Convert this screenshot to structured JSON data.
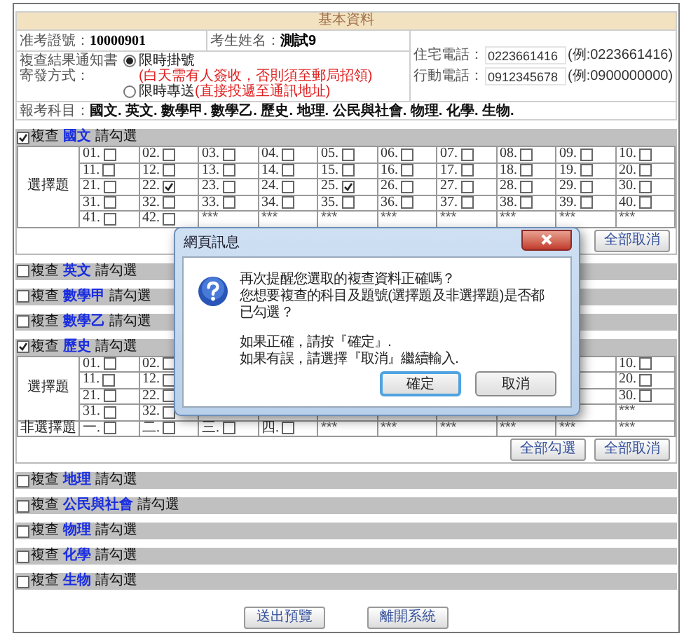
{
  "basic_info": {
    "title": "基本資料",
    "exam_no": {
      "label": "准考證號：",
      "value": "10000901"
    },
    "name": {
      "label": "考生姓名：",
      "value": "測試9"
    },
    "phones": [
      {
        "label": "住宅電話：",
        "value": "0223661416",
        "example": "(例:0223661416)"
      },
      {
        "label": "行動電話：",
        "value": "0912345678",
        "example": "(例:0900000000)"
      }
    ],
    "delivery": {
      "label": "複查結果通知書寄發方式：",
      "options": [
        {
          "label": "限時掛號",
          "note": "(白天需有人簽收，否則須至郵局招領)",
          "selected": true
        },
        {
          "label": "限時專送",
          "note": "(直接投遞至通訊地址)",
          "selected": false
        }
      ]
    },
    "subjects": {
      "label": "報考科目：",
      "value": "國文. 英文. 數學甲. 數學乙. 歷史. 地理. 公民與社會. 物理. 化學. 生物."
    }
  },
  "sections": [
    {
      "prefix": "複查",
      "subject": "國文",
      "suffix": "請勾選",
      "checked": true,
      "table": {
        "groups": [
          {
            "label": "選擇題",
            "rows": [
              [
                {
                  "kind": "item",
                  "label": "01.",
                  "checked": false
                },
                {
                  "kind": "item",
                  "label": "02.",
                  "checked": false
                },
                {
                  "kind": "item",
                  "label": "03.",
                  "checked": false
                },
                {
                  "kind": "item",
                  "label": "04.",
                  "checked": false
                },
                {
                  "kind": "item",
                  "label": "05.",
                  "checked": false
                },
                {
                  "kind": "item",
                  "label": "06.",
                  "checked": false
                },
                {
                  "kind": "item",
                  "label": "07.",
                  "checked": false
                },
                {
                  "kind": "item",
                  "label": "08.",
                  "checked": false
                },
                {
                  "kind": "item",
                  "label": "09.",
                  "checked": false
                },
                {
                  "kind": "item",
                  "label": "10.",
                  "checked": false
                }
              ],
              [
                {
                  "kind": "item",
                  "label": "11.",
                  "checked": false
                },
                {
                  "kind": "item",
                  "label": "12.",
                  "checked": false
                },
                {
                  "kind": "item",
                  "label": "13.",
                  "checked": false
                },
                {
                  "kind": "item",
                  "label": "14.",
                  "checked": false
                },
                {
                  "kind": "item",
                  "label": "15.",
                  "checked": false
                },
                {
                  "kind": "item",
                  "label": "16.",
                  "checked": false
                },
                {
                  "kind": "item",
                  "label": "17.",
                  "checked": false
                },
                {
                  "kind": "item",
                  "label": "18.",
                  "checked": false
                },
                {
                  "kind": "item",
                  "label": "19.",
                  "checked": false
                },
                {
                  "kind": "item",
                  "label": "20.",
                  "checked": false
                }
              ],
              [
                {
                  "kind": "item",
                  "label": "21.",
                  "checked": false
                },
                {
                  "kind": "item",
                  "label": "22.",
                  "checked": true
                },
                {
                  "kind": "item",
                  "label": "23.",
                  "checked": false
                },
                {
                  "kind": "item",
                  "label": "24.",
                  "checked": false
                },
                {
                  "kind": "item",
                  "label": "25.",
                  "checked": true
                },
                {
                  "kind": "item",
                  "label": "26.",
                  "checked": false
                },
                {
                  "kind": "item",
                  "label": "27.",
                  "checked": false
                },
                {
                  "kind": "item",
                  "label": "28.",
                  "checked": false
                },
                {
                  "kind": "item",
                  "label": "29.",
                  "checked": false
                },
                {
                  "kind": "item",
                  "label": "30.",
                  "checked": false
                }
              ],
              [
                {
                  "kind": "item",
                  "label": "31.",
                  "checked": false
                },
                {
                  "kind": "item",
                  "label": "32.",
                  "checked": false
                },
                {
                  "kind": "item",
                  "label": "33.",
                  "checked": false
                },
                {
                  "kind": "item",
                  "label": "34.",
                  "checked": false
                },
                {
                  "kind": "item",
                  "label": "35.",
                  "checked": false
                },
                {
                  "kind": "item",
                  "label": "36.",
                  "checked": false
                },
                {
                  "kind": "item",
                  "label": "37.",
                  "checked": false
                },
                {
                  "kind": "item",
                  "label": "38.",
                  "checked": false
                },
                {
                  "kind": "item",
                  "label": "39.",
                  "checked": false
                },
                {
                  "kind": "item",
                  "label": "40.",
                  "checked": false
                }
              ],
              [
                {
                  "kind": "item",
                  "label": "41.",
                  "checked": false
                },
                {
                  "kind": "item",
                  "label": "42.",
                  "checked": false
                },
                {
                  "kind": "text",
                  "text": "***"
                },
                {
                  "kind": "text",
                  "text": "***"
                },
                {
                  "kind": "text",
                  "text": "***"
                },
                {
                  "kind": "text",
                  "text": "***"
                },
                {
                  "kind": "text",
                  "text": "***"
                },
                {
                  "kind": "text",
                  "text": "***"
                },
                {
                  "kind": "text",
                  "text": "***"
                },
                {
                  "kind": "text",
                  "text": "***"
                }
              ]
            ]
          }
        ]
      },
      "buttons": [
        "全部取消"
      ]
    },
    {
      "prefix": "複查",
      "subject": "英文",
      "suffix": "請勾選",
      "checked": false
    },
    {
      "prefix": "複查",
      "subject": "數學甲",
      "suffix": "請勾選",
      "checked": false
    },
    {
      "prefix": "複查",
      "subject": "數學乙",
      "suffix": "請勾選",
      "checked": false
    },
    {
      "prefix": "複查",
      "subject": "歷史",
      "suffix": "請勾選",
      "checked": true,
      "table": {
        "groups": [
          {
            "label": "選擇題",
            "rows": [
              [
                {
                  "kind": "item",
                  "label": "01.",
                  "checked": false
                },
                {
                  "kind": "item",
                  "label": "02.",
                  "checked": false
                },
                null,
                null,
                null,
                null,
                null,
                null,
                null,
                {
                  "kind": "item",
                  "label": "10.",
                  "checked": false
                }
              ],
              [
                {
                  "kind": "item",
                  "label": "11.",
                  "checked": false
                },
                {
                  "kind": "item",
                  "label": "12.",
                  "checked": false
                },
                null,
                null,
                null,
                null,
                null,
                null,
                null,
                {
                  "kind": "item",
                  "label": "20.",
                  "checked": false
                }
              ],
              [
                {
                  "kind": "item",
                  "label": "21.",
                  "checked": false
                },
                {
                  "kind": "item",
                  "label": "22.",
                  "checked": false
                },
                null,
                null,
                null,
                null,
                null,
                null,
                null,
                {
                  "kind": "item",
                  "label": "30.",
                  "checked": false
                }
              ],
              [
                {
                  "kind": "item",
                  "label": "31.",
                  "checked": false
                },
                {
                  "kind": "item",
                  "label": "32.",
                  "checked": false
                },
                null,
                null,
                null,
                null,
                null,
                null,
                null,
                {
                  "kind": "text",
                  "text": "***"
                }
              ]
            ]
          },
          {
            "label": "非選擇題",
            "rows": [
              [
                {
                  "kind": "item",
                  "label": "一.",
                  "checked": false
                },
                {
                  "kind": "item",
                  "label": "二.",
                  "checked": false
                },
                {
                  "kind": "item",
                  "label": "三.",
                  "checked": false
                },
                {
                  "kind": "item",
                  "label": "四.",
                  "checked": false
                },
                {
                  "kind": "text",
                  "text": "***"
                },
                {
                  "kind": "text",
                  "text": "***"
                },
                {
                  "kind": "text",
                  "text": "***"
                },
                {
                  "kind": "text",
                  "text": "***"
                },
                {
                  "kind": "text",
                  "text": "***"
                },
                {
                  "kind": "text",
                  "text": "***"
                }
              ]
            ]
          }
        ]
      },
      "buttons": [
        "全部勾選",
        "全部取消"
      ]
    },
    {
      "prefix": "複查",
      "subject": "地理",
      "suffix": "請勾選",
      "checked": false
    },
    {
      "prefix": "複查",
      "subject": "公民與社會",
      "suffix": "請勾選",
      "checked": false
    },
    {
      "prefix": "複查",
      "subject": "物理",
      "suffix": "請勾選",
      "checked": false
    },
    {
      "prefix": "複查",
      "subject": "化學",
      "suffix": "請勾選",
      "checked": false
    },
    {
      "prefix": "複查",
      "subject": "生物",
      "suffix": "請勾選",
      "checked": false
    }
  ],
  "bottom_buttons": [
    "送出預覽",
    "離開系統"
  ],
  "dialog": {
    "title": "網頁訊息",
    "paragraphs": [
      [
        "再次提醒您選取的複查資料正確嗎？",
        "您想要複查的科目及題號(選擇題及非選擇題)是否都已勾選？"
      ],
      [
        "如果正確，請按『確定』.",
        "如果有誤，請選擇『取消』繼續輸入."
      ]
    ],
    "buttons": [
      {
        "label": "確定",
        "selected": true
      },
      {
        "label": "取消",
        "selected": false
      }
    ]
  }
}
